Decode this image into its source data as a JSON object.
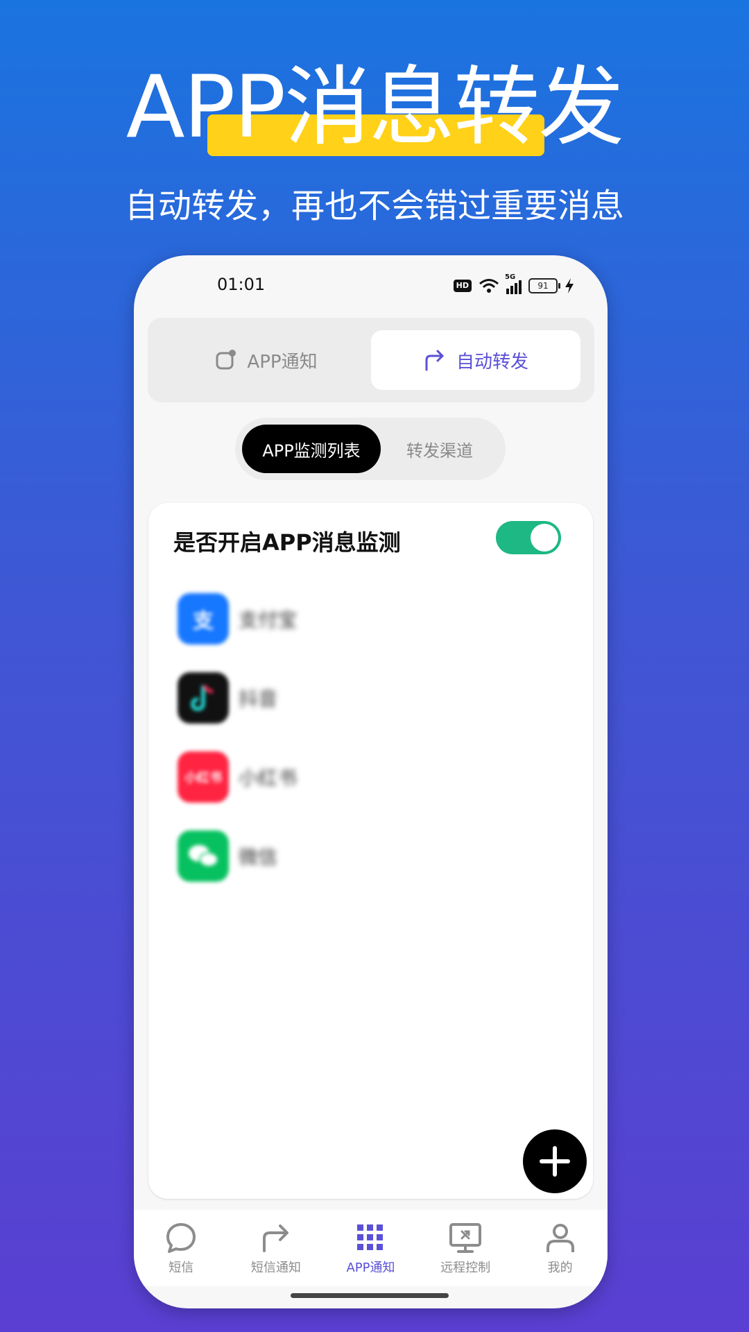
{
  "hero": {
    "title": "APP消息转发",
    "subtitle": "自动转发，再也不会错过重要消息"
  },
  "status_bar": {
    "time": "01:01",
    "hd": "HD",
    "network": "5G",
    "battery": "91"
  },
  "top_tabs": [
    {
      "label": "APP通知",
      "icon": "notification-icon",
      "active": false
    },
    {
      "label": "自动转发",
      "icon": "forward-arrow-icon",
      "active": true
    }
  ],
  "sub_tabs": [
    {
      "label": "APP监测列表",
      "active": true
    },
    {
      "label": "转发渠道",
      "active": false
    }
  ],
  "monitor": {
    "title": "是否开启APP消息监测",
    "enabled": true
  },
  "apps": [
    {
      "name": "支付宝",
      "icon": "alipay-icon",
      "color": "#1677ff"
    },
    {
      "name": "抖音",
      "icon": "douyin-icon",
      "color": "#111111"
    },
    {
      "name": "小红书",
      "icon": "xiaohongshu-icon",
      "color": "#ff2442"
    },
    {
      "name": "微信",
      "icon": "wechat-icon",
      "color": "#07c160"
    }
  ],
  "fab": {
    "icon": "plus-icon"
  },
  "bottom_nav": [
    {
      "label": "短信",
      "icon": "chat-bubble-icon",
      "active": false
    },
    {
      "label": "短信通知",
      "icon": "forward-arrow-icon",
      "active": false
    },
    {
      "label": "APP通知",
      "icon": "grid-icon",
      "active": true
    },
    {
      "label": "远程控制",
      "icon": "remote-monitor-icon",
      "active": false
    },
    {
      "label": "我的",
      "icon": "user-icon",
      "active": false
    }
  ],
  "colors": {
    "accent": "#5a50d8",
    "highlight": "#ffd118",
    "toggle_on": "#1db883"
  }
}
